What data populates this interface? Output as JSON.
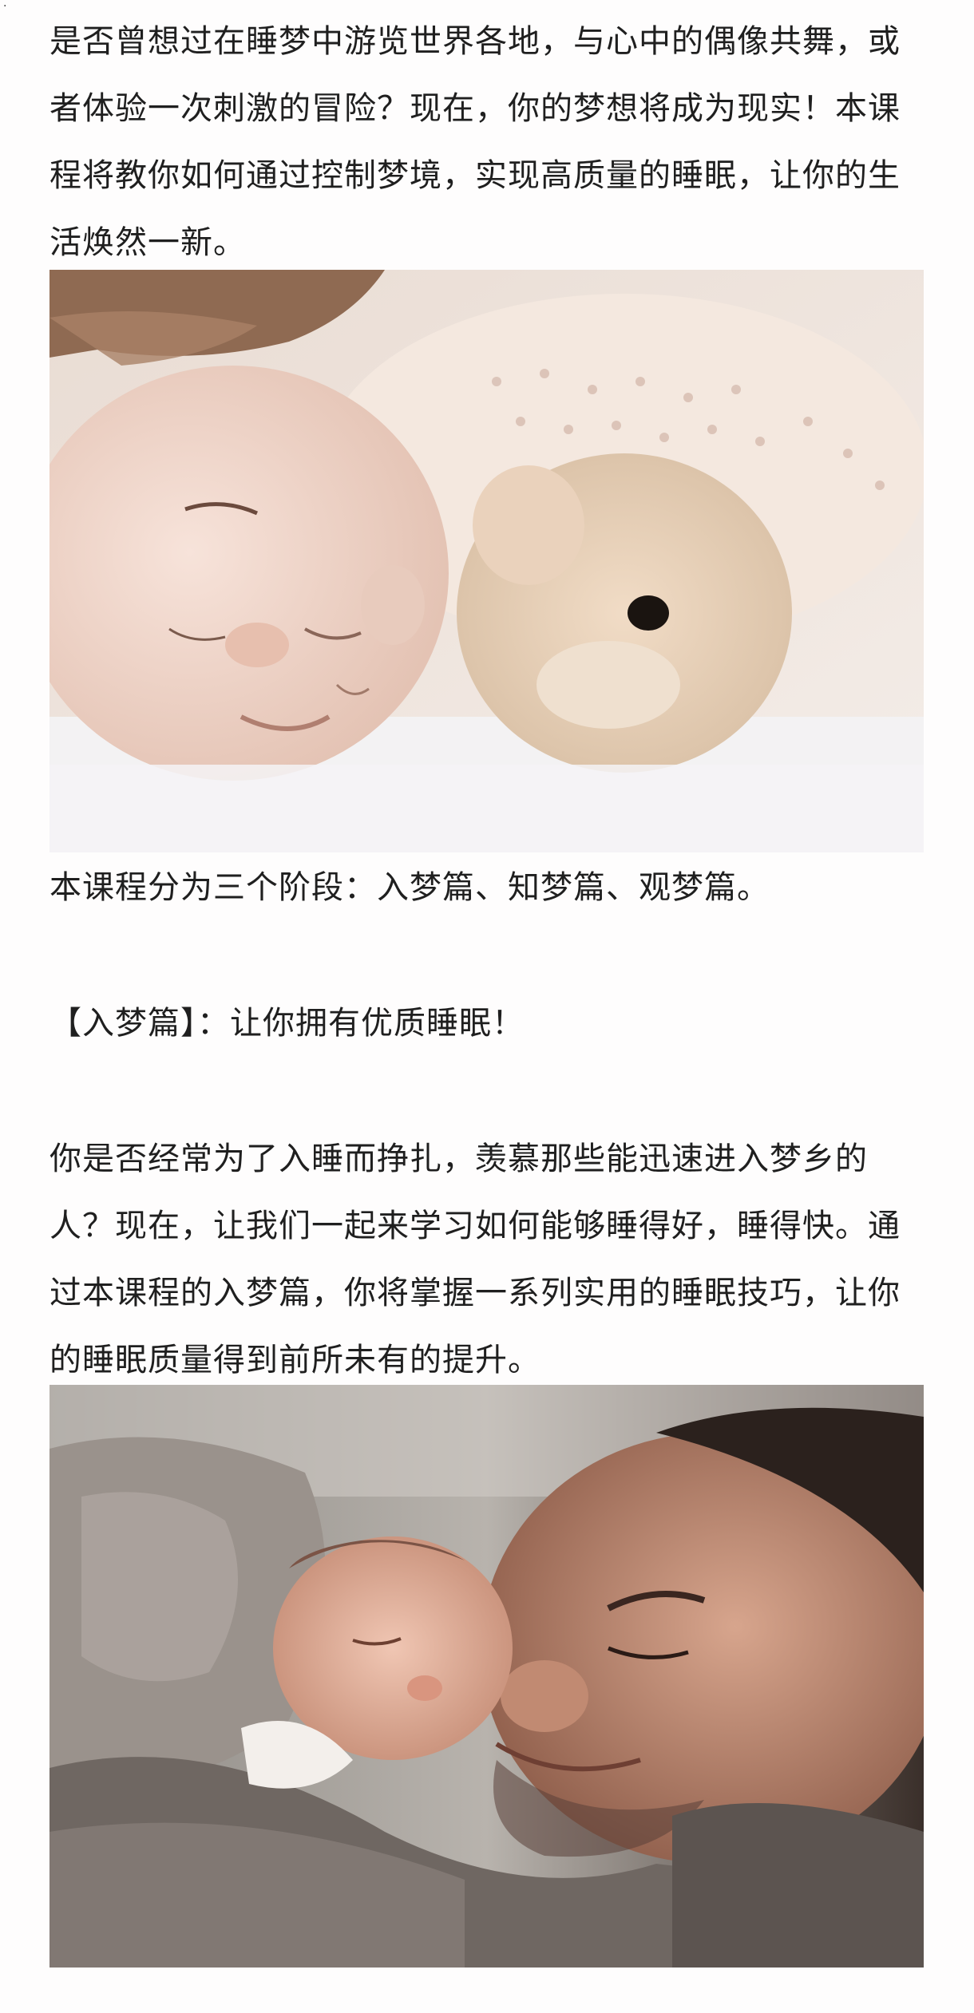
{
  "article": {
    "intro": "是否曾想过在睡梦中游览世界各地，与心中的偶像共舞，或者体验一次刺激的冒险？现在，你的梦想将成为现实！本课程将教你如何通过控制梦境，实现高质量的睡眠，让你的生活焕然一新。",
    "stages": "本课程分为三个阶段：入梦篇、知梦篇、观梦篇。",
    "section_heading": "【入梦篇】：让你拥有优质睡眠！",
    "section_body": "你是否经常为了入睡而挣扎，羡慕那些能迅速进入梦乡的人？现在，让我们一起来学习如何能够睡得好，睡得快。通过本课程的入梦篇，你将掌握一系列实用的睡眠技巧，让你的睡眠质量得到前所未有的提升。"
  },
  "images": {
    "photo1_icon": "sleeping-child-with-teddy-bear",
    "photo2_icon": "sleeping-father-with-newborn"
  },
  "colors": {
    "text": "#1f1f1f",
    "background": "#fefdfd"
  }
}
